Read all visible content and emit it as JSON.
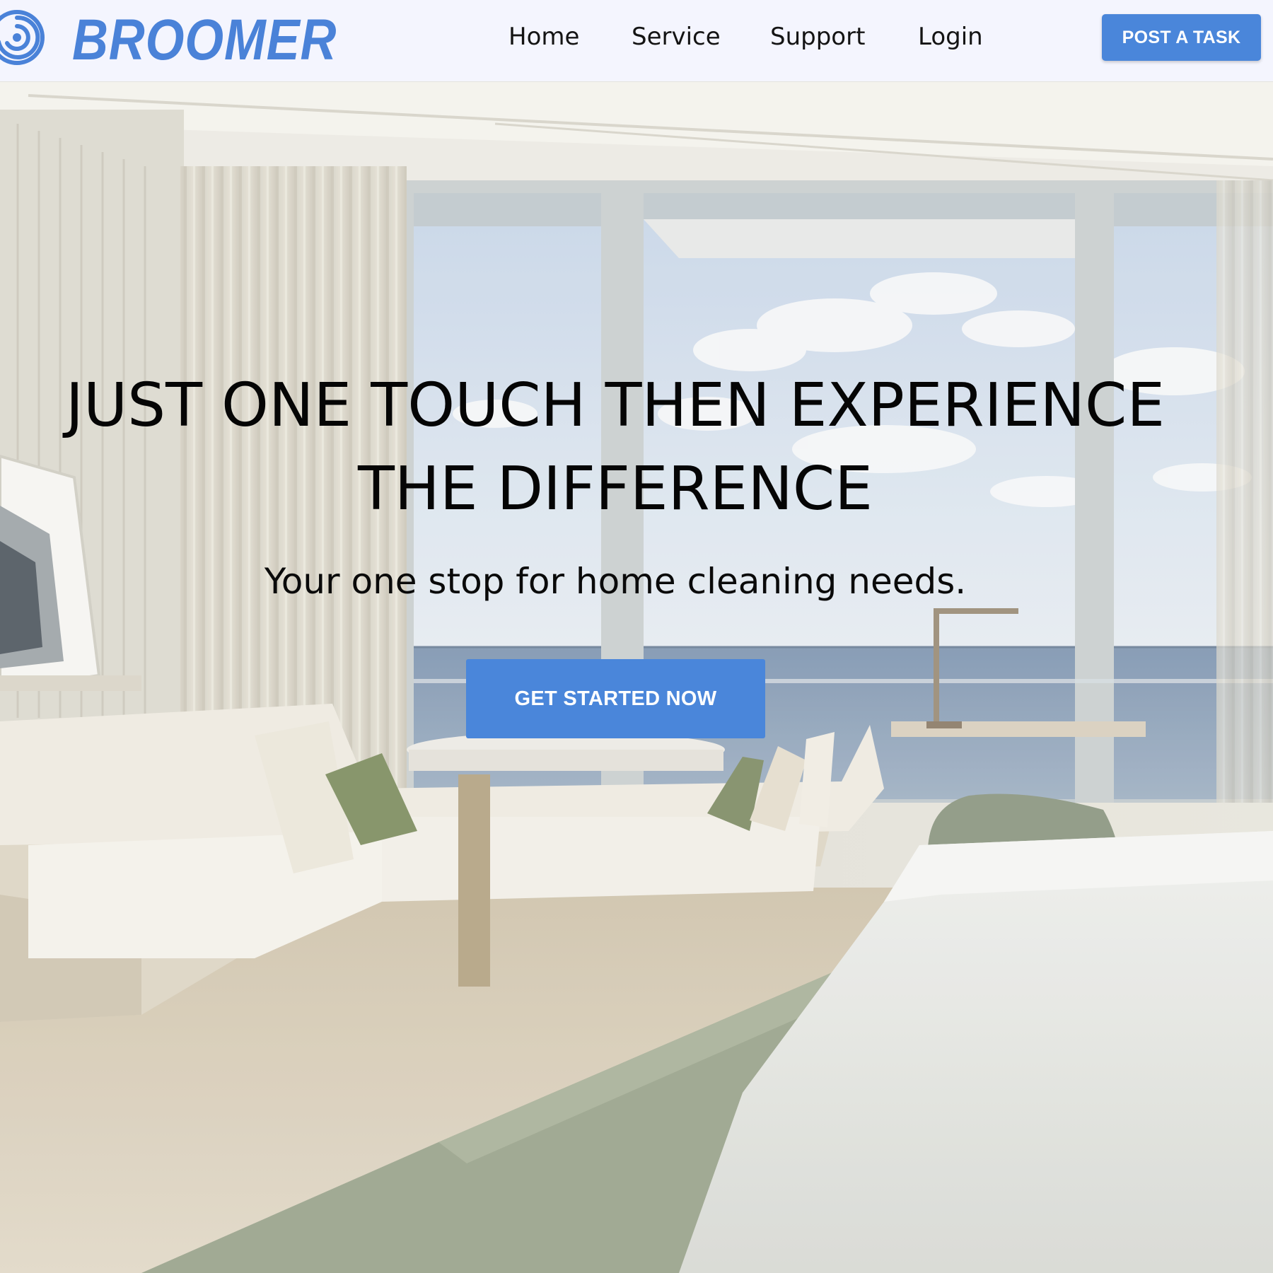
{
  "header": {
    "brand": "BROOMER",
    "logo_icon": "swirl-logo-icon",
    "nav": [
      {
        "label": "Home"
      },
      {
        "label": "Service"
      },
      {
        "label": "Support"
      },
      {
        "label": "Login"
      }
    ],
    "post_task_label": "POST A TASK"
  },
  "hero": {
    "title_line1": "JUST ONE TOUCH THEN EXPERIENCE",
    "title_line2": "THE DIFFERENCE",
    "subtitle": "Your one stop for home cleaning needs.",
    "cta_label": "GET STARTED NOW",
    "background": "hotel-room-ocean-view-photo"
  },
  "colors": {
    "accent": "#4a86da",
    "brand": "#4a82d8",
    "navbar_bg": "#f4f5fe",
    "text": "#050505"
  }
}
